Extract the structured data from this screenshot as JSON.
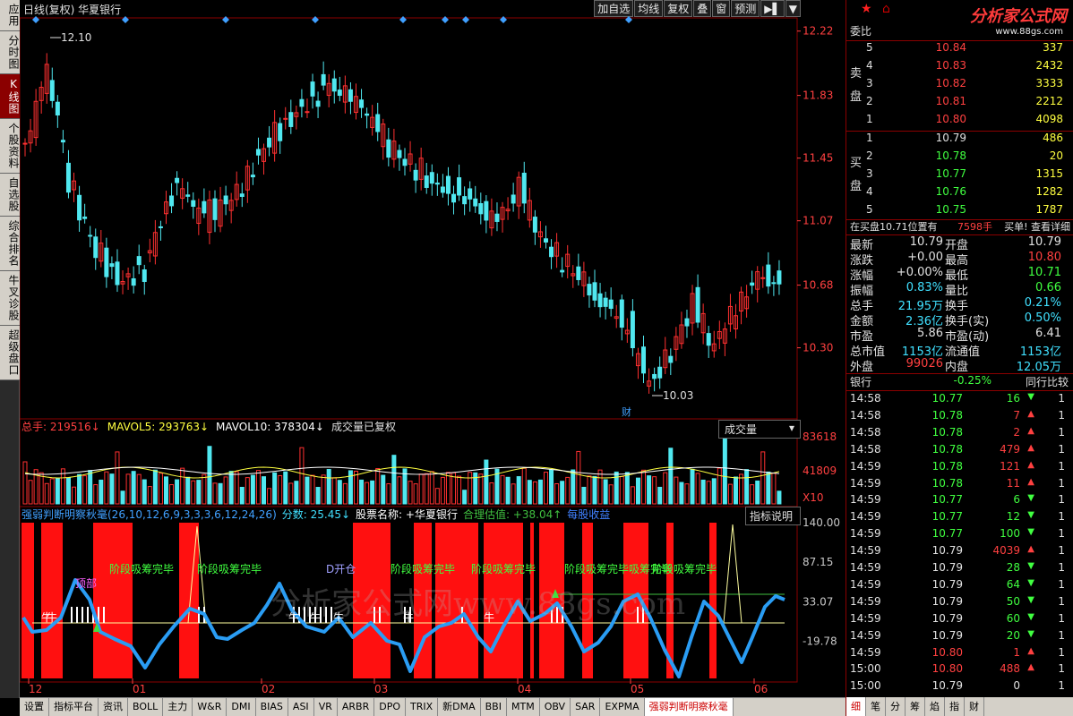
{
  "sidebar": {
    "tabs": [
      {
        "label": "应用",
        "active": false
      },
      {
        "label": "分时图",
        "active": false
      },
      {
        "label": "K线图",
        "active": true
      },
      {
        "label": "个股资料",
        "active": false
      },
      {
        "label": "自选股",
        "active": false
      },
      {
        "label": "综合排名",
        "active": false
      },
      {
        "label": "牛叉诊股",
        "active": false
      },
      {
        "label": "超级盘口",
        "active": false
      }
    ]
  },
  "header": {
    "title": "日线(复权)  华夏银行",
    "toolbar": [
      "加自选",
      "均线",
      "复权",
      "叠",
      "窗",
      "预测"
    ]
  },
  "kline": {
    "price_axis": [
      "12.22",
      "11.83",
      "11.45",
      "11.07",
      "10.68",
      "10.30"
    ],
    "high_label": "12.10",
    "low_label": "10.03",
    "cai_label": "财",
    "price_range": [
      9.9,
      12.22
    ]
  },
  "volume": {
    "legend_total": "总手: 219516↓",
    "legend_mavol5": "MAVOL5: 293763↓",
    "legend_mavol10": "MAVOL10: 378304↓",
    "legend_note": "成交量已复权",
    "dropdown": "成交量",
    "axis": [
      "83618",
      "41809",
      "X10"
    ]
  },
  "indicator": {
    "legend_name": "强弱判断明察秋毫(26,10,12,6,9,3,3,3,6,12,24,26)",
    "legend_score": "分数: 25.45↓",
    "legend_stock": "股票名称: +华夏银行",
    "legend_value": "合理估值: +38.04↑",
    "legend_extra": "每股收益",
    "explain_button": "指标说明",
    "axis": [
      "140.00",
      "87.15",
      "33.07",
      "-19.78"
    ],
    "labels": {
      "stage": "阶段吸筹完毕",
      "stage_overlap": "阶段吸筹完毕吸筹完毕",
      "open": "D开仓",
      "top": "顶部",
      "bull": "牛"
    },
    "watermark": "分析家公式网www.88gs.com"
  },
  "x_axis": [
    "12",
    "01",
    "02",
    "03",
    "04",
    "05",
    "06"
  ],
  "bottom_tabs": [
    "设置",
    "指标平台",
    "资讯",
    "BOLL",
    "主力",
    "W&R",
    "DMI",
    "BIAS",
    "ASI",
    "VR",
    "ARBR",
    "DPO",
    "TRIX",
    "新DMA",
    "BBI",
    "MTM",
    "OBV",
    "SAR",
    "EXPMA",
    "强弱判断明察秋毫"
  ],
  "active_bottom_tab": "强弱判断明察秋毫",
  "right_panel": {
    "logo": "分析家公式网",
    "logo_url": "www.88gs.com",
    "weibi_label": "委比",
    "sell_label": "卖盘",
    "buy_label": "买盘",
    "sell": [
      {
        "n": "5",
        "price": "10.84",
        "vol": "337"
      },
      {
        "n": "4",
        "price": "10.83",
        "vol": "2432"
      },
      {
        "n": "3",
        "price": "10.82",
        "vol": "3333"
      },
      {
        "n": "2",
        "price": "10.81",
        "vol": "2212"
      },
      {
        "n": "1",
        "price": "10.80",
        "vol": "4098"
      }
    ],
    "buy": [
      {
        "n": "1",
        "price": "10.79",
        "vol": "486"
      },
      {
        "n": "2",
        "price": "10.78",
        "vol": "20"
      },
      {
        "n": "3",
        "price": "10.77",
        "vol": "1315"
      },
      {
        "n": "4",
        "price": "10.76",
        "vol": "1282"
      },
      {
        "n": "5",
        "price": "10.75",
        "vol": "1787"
      }
    ],
    "notice": "在买盘10.71位置有",
    "notice_vol": "7598手",
    "notice_tail": "买单! 查看详细",
    "quote_rows": [
      {
        "l1": "最新",
        "v1": "10.79",
        "c1": "white",
        "l2": "开盘",
        "v2": "10.79",
        "c2": "white"
      },
      {
        "l1": "涨跌",
        "v1": "+0.00",
        "c1": "white",
        "l2": "最高",
        "v2": "10.80",
        "c2": "red"
      },
      {
        "l1": "涨幅",
        "v1": "+0.00%",
        "c1": "white",
        "l2": "最低",
        "v2": "10.71",
        "c2": "green"
      },
      {
        "l1": "振幅",
        "v1": "0.83%",
        "c1": "cyan",
        "l2": "量比",
        "v2": "0.66",
        "c2": "green"
      },
      {
        "l1": "总手",
        "v1": "21.95万",
        "c1": "cyan",
        "l2": "换手",
        "v2": "0.21%",
        "c2": "cyan"
      },
      {
        "l1": "金额",
        "v1": "2.36亿",
        "c1": "cyan",
        "l2": "换手(实)",
        "v2": "0.50%",
        "c2": "cyan"
      },
      {
        "l1": "市盈",
        "v1": "5.86",
        "c1": "white",
        "l2": "市盈(动)",
        "v2": "6.41",
        "c2": "white"
      },
      {
        "l1": "总市值",
        "v1": "1153亿",
        "c1": "cyan",
        "l2": "流通值",
        "v2": "1153亿",
        "c2": "cyan"
      },
      {
        "l1": "外盘",
        "v1": "99026",
        "c1": "red",
        "l2": "内盘",
        "v2": "12.05万",
        "c2": "cyan"
      }
    ],
    "sector_name": "银行",
    "sector_change": "-0.25%",
    "sector_compare": "同行比较",
    "ticks": [
      {
        "time": "14:58",
        "price": "10.77",
        "pc": "green",
        "vol": "16",
        "dir": "down",
        "n": "1"
      },
      {
        "time": "14:58",
        "price": "10.78",
        "pc": "green",
        "vol": "7",
        "dir": "up",
        "n": "1"
      },
      {
        "time": "14:58",
        "price": "10.78",
        "pc": "green",
        "vol": "2",
        "dir": "up",
        "n": "1"
      },
      {
        "time": "14:58",
        "price": "10.78",
        "pc": "green",
        "vol": "479",
        "dir": "up",
        "n": "1"
      },
      {
        "time": "14:59",
        "price": "10.78",
        "pc": "green",
        "vol": "121",
        "dir": "up",
        "n": "1"
      },
      {
        "time": "14:59",
        "price": "10.78",
        "pc": "green",
        "vol": "11",
        "dir": "up",
        "n": "1"
      },
      {
        "time": "14:59",
        "price": "10.77",
        "pc": "green",
        "vol": "6",
        "dir": "down",
        "n": "1"
      },
      {
        "time": "14:59",
        "price": "10.77",
        "pc": "green",
        "vol": "12",
        "dir": "down",
        "n": "1"
      },
      {
        "time": "14:59",
        "price": "10.77",
        "pc": "green",
        "vol": "100",
        "dir": "down",
        "n": "1"
      },
      {
        "time": "14:59",
        "price": "10.79",
        "pc": "white",
        "vol": "4039",
        "dir": "up",
        "n": "1"
      },
      {
        "time": "14:59",
        "price": "10.79",
        "pc": "white",
        "vol": "28",
        "dir": "down",
        "n": "1"
      },
      {
        "time": "14:59",
        "price": "10.79",
        "pc": "white",
        "vol": "64",
        "dir": "down",
        "n": "1"
      },
      {
        "time": "14:59",
        "price": "10.79",
        "pc": "white",
        "vol": "50",
        "dir": "down",
        "n": "1"
      },
      {
        "time": "14:59",
        "price": "10.79",
        "pc": "white",
        "vol": "60",
        "dir": "down",
        "n": "1"
      },
      {
        "time": "14:59",
        "price": "10.79",
        "pc": "white",
        "vol": "20",
        "dir": "down",
        "n": "1"
      },
      {
        "time": "14:59",
        "price": "10.80",
        "pc": "red",
        "vol": "1",
        "dir": "up",
        "n": "1"
      },
      {
        "time": "15:00",
        "price": "10.80",
        "pc": "red",
        "vol": "488",
        "dir": "up",
        "n": "1"
      },
      {
        "time": "15:00",
        "price": "10.79",
        "pc": "white",
        "vol": "0",
        "dir": "none",
        "n": "1"
      }
    ],
    "bottom_tabs": [
      "细",
      "笔",
      "分",
      "筹",
      "焰",
      "指",
      "财"
    ]
  },
  "colors": {
    "up": "#ff3030",
    "down": "#50e8f0",
    "bg": "#000000",
    "grid": "#8b0000",
    "axis_text": "#ff4040",
    "indicator_line": "#2a9df4",
    "indicator_fill": "#ff1010"
  }
}
